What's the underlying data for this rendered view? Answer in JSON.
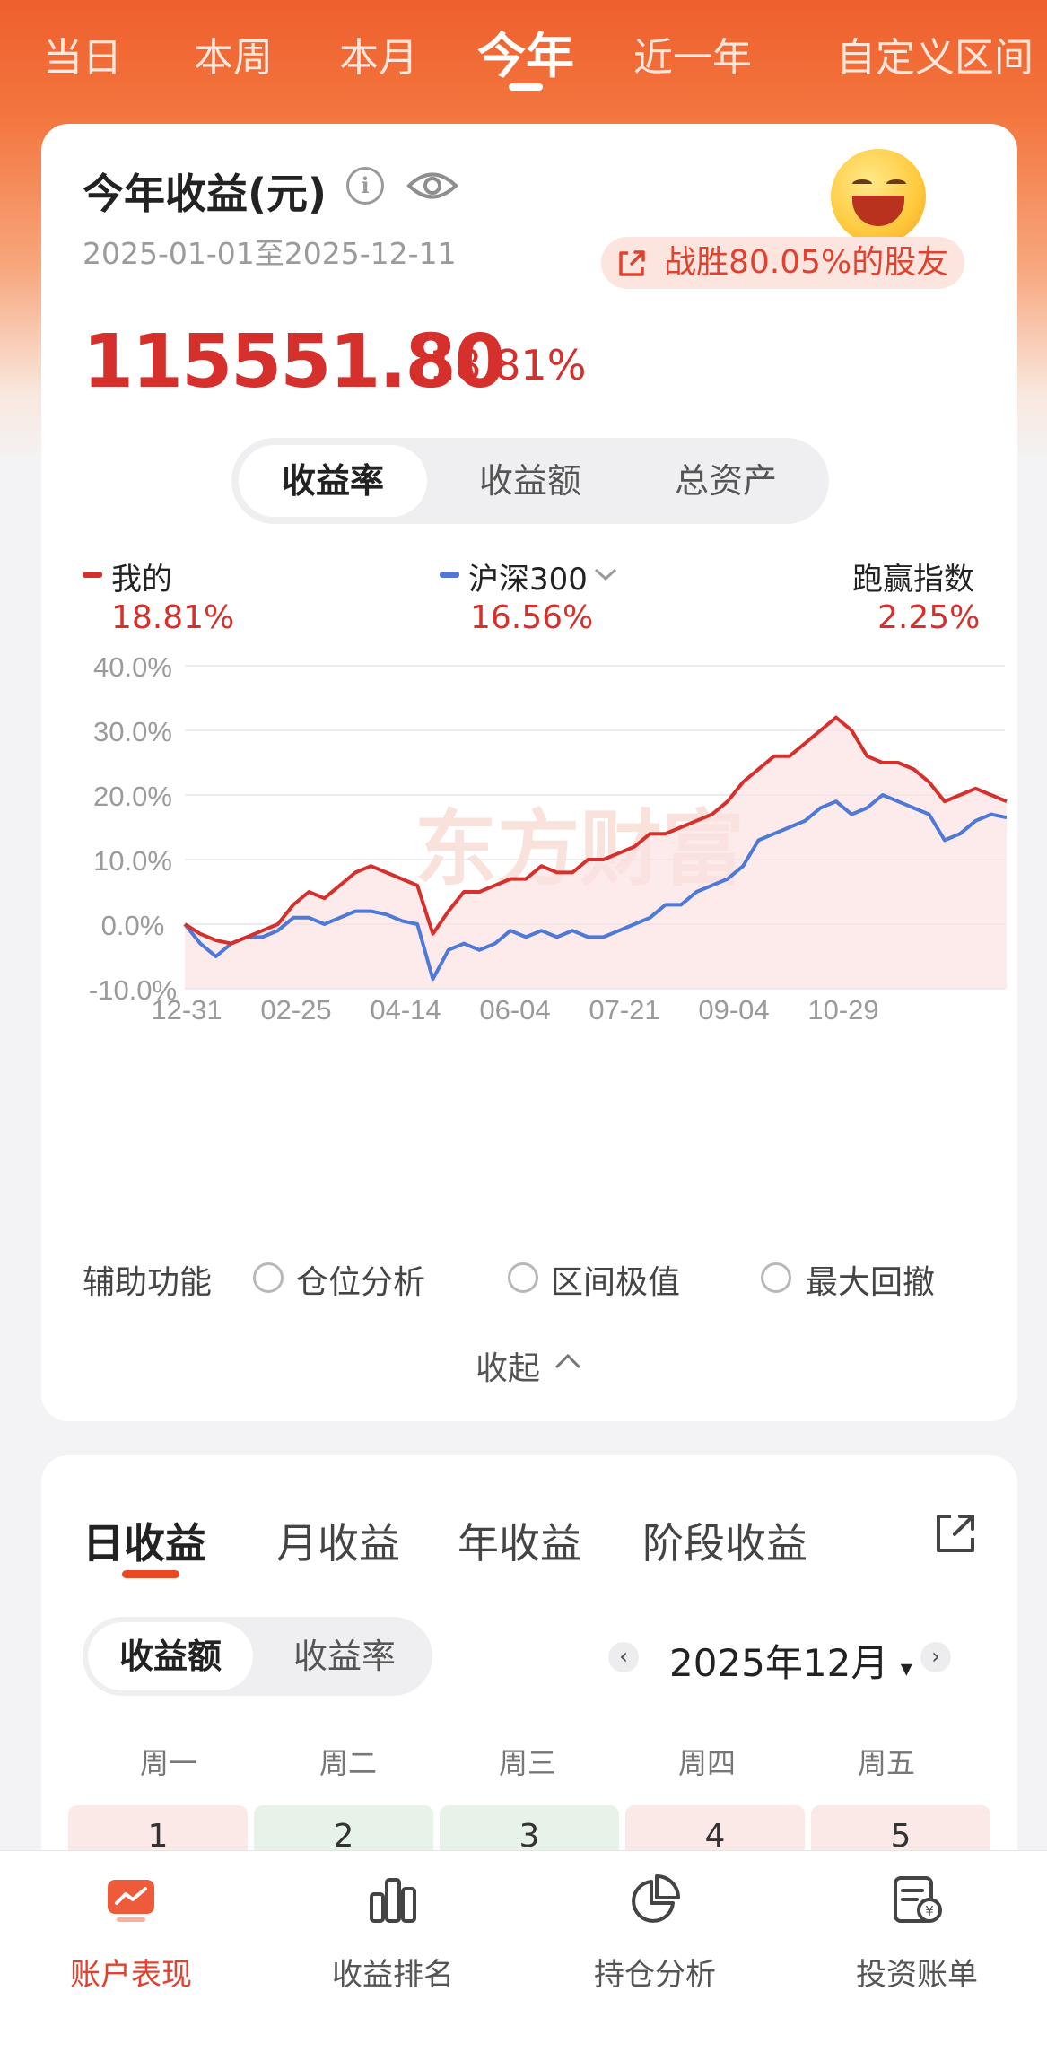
{
  "period_tabs": [
    {
      "label": "当日",
      "active": false
    },
    {
      "label": "本周",
      "active": false
    },
    {
      "label": "本月",
      "active": false
    },
    {
      "label": "今年",
      "active": true
    },
    {
      "label": "近一年",
      "active": false
    },
    {
      "label": "自定义区间",
      "active": false
    }
  ],
  "summary": {
    "title": "今年收益(元)",
    "date_range": "2025-01-01至2025-12-11",
    "beat_text": "战胜80.05%的股友",
    "amount": "115551.80",
    "percent": "18.81%"
  },
  "metric_tabs": [
    {
      "label": "收益率",
      "active": true
    },
    {
      "label": "收益额",
      "active": false
    },
    {
      "label": "总资产",
      "active": false
    }
  ],
  "legend": {
    "mine_label": "我的",
    "mine_value": "18.81%",
    "index_label": "沪深300",
    "index_value": "16.56%",
    "excess_label": "跑赢指数",
    "excess_value": "2.25%"
  },
  "colors": {
    "accent": "#e0422f",
    "mine": "#d6302d",
    "index": "#4f79d8"
  },
  "chart_data": {
    "type": "line",
    "x_ticks": [
      "12-31",
      "02-25",
      "04-14",
      "06-04",
      "07-21",
      "09-04",
      "10-29"
    ],
    "y_ticks": [
      "40.0%",
      "30.0%",
      "20.0%",
      "10.0%",
      "0.0%",
      "-10.0%"
    ],
    "ylim": [
      -10,
      40
    ],
    "grid": true,
    "watermark": "东方财富",
    "series": [
      {
        "name": "我的",
        "color": "#d6302d",
        "values": [
          0,
          -1.5,
          -2.5,
          -3,
          -2,
          -1,
          0,
          3,
          5,
          4,
          6,
          8,
          9,
          8,
          7,
          6,
          -1.5,
          2,
          5,
          5,
          6,
          7,
          7,
          9,
          8,
          8,
          10,
          10,
          11,
          12,
          14,
          14,
          15,
          16,
          17,
          19,
          22,
          24,
          26,
          26,
          28,
          30,
          32,
          30,
          26,
          25,
          25,
          24,
          22,
          19,
          20,
          21,
          20,
          19
        ]
      },
      {
        "name": "沪深300",
        "color": "#4f79d8",
        "values": [
          0,
          -3,
          -5,
          -3,
          -2,
          -2,
          -1,
          1,
          1,
          0,
          1,
          2,
          2,
          1.5,
          0.5,
          0,
          -8.5,
          -4,
          -3,
          -4,
          -3,
          -1,
          -2,
          -1,
          -2,
          -1,
          -2,
          -2,
          -1,
          0,
          1,
          3,
          3,
          5,
          6,
          7,
          9,
          13,
          14,
          15,
          16,
          18,
          19,
          17,
          18,
          20,
          19,
          18,
          17,
          13,
          14,
          16,
          17,
          16.5
        ]
      }
    ]
  },
  "aux": {
    "label": "辅助功能",
    "options": [
      "仓位分析",
      "区间极值",
      "最大回撤"
    ],
    "collapse_label": "收起"
  },
  "returns_tabs": [
    {
      "label": "日收益",
      "active": true
    },
    {
      "label": "月收益",
      "active": false
    },
    {
      "label": "年收益",
      "active": false
    },
    {
      "label": "阶段收益",
      "active": false
    }
  ],
  "returns_mode": [
    {
      "label": "收益额",
      "active": true
    },
    {
      "label": "收益率",
      "active": false
    }
  ],
  "month_label": "2025年12月",
  "weekdays": [
    "周一",
    "周二",
    "周三",
    "周四",
    "周五"
  ],
  "days": [
    {
      "day": "1",
      "tone": "up"
    },
    {
      "day": "2",
      "tone": "down"
    },
    {
      "day": "3",
      "tone": "down"
    },
    {
      "day": "4",
      "tone": "up"
    },
    {
      "day": "5",
      "tone": "up"
    }
  ],
  "bottom_nav": [
    {
      "label": "账户表现",
      "icon": "chart-trend-icon",
      "active": true
    },
    {
      "label": "收益排名",
      "icon": "bar-chart-icon",
      "active": false
    },
    {
      "label": "持仓分析",
      "icon": "pie-chart-icon",
      "active": false
    },
    {
      "label": "投资账单",
      "icon": "bill-icon",
      "active": false
    }
  ]
}
